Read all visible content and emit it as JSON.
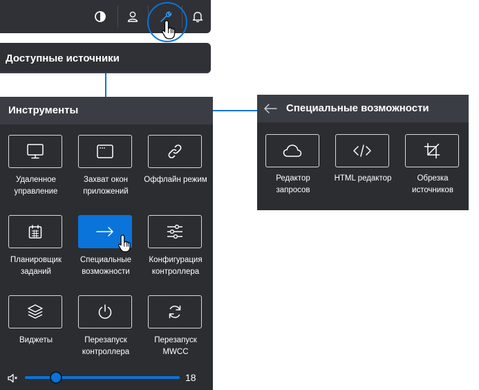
{
  "colors": {
    "accent": "#0a74da",
    "panel_bg": "#2b2d31",
    "header_bg": "#3a3d44",
    "text": "#ffffff"
  },
  "toolbar": {
    "icons": [
      "contrast-icon",
      "user-icon",
      "wrench-icon",
      "bell-icon"
    ]
  },
  "sources": {
    "title": "Доступные источники"
  },
  "tools_panel": {
    "title": "Инструменты",
    "items": [
      {
        "label": "Удаленное управление",
        "icon": "monitor-icon"
      },
      {
        "label": "Захват окон приложений",
        "icon": "window-icon"
      },
      {
        "label": "Оффлайн режим",
        "icon": "link-icon"
      },
      {
        "label": "Планировщик заданий",
        "icon": "calendar-icon"
      },
      {
        "label": "Специальные возможности",
        "icon": "arrow-right-icon"
      },
      {
        "label": "Конфигурация контроллера",
        "icon": "sliders-icon"
      },
      {
        "label": "Виджеты",
        "icon": "layers-icon"
      },
      {
        "label": "Перезапуск контроллера",
        "icon": "power-icon"
      },
      {
        "label": "Перезапуск MWCC",
        "icon": "refresh-icon"
      }
    ],
    "volume": {
      "value": "18",
      "level": 0.2,
      "icon": "volume-icon"
    }
  },
  "special_panel": {
    "title": "Специальные возможности",
    "back_icon": "arrow-left-icon",
    "items": [
      {
        "label": "Редактор запросов",
        "icon": "cloud-icon"
      },
      {
        "label": "HTML редактор",
        "icon": "code-icon"
      },
      {
        "label": "Обрезка источников",
        "icon": "crop-icon"
      }
    ]
  }
}
